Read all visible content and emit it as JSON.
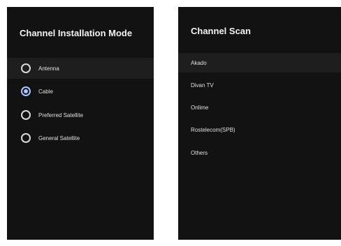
{
  "installation_mode": {
    "title": "Channel Installation Mode",
    "options": [
      {
        "label": "Antenna",
        "selected": false,
        "focused": true
      },
      {
        "label": "Cable",
        "selected": true,
        "focused": false
      },
      {
        "label": "Preferred Satellite",
        "selected": false,
        "focused": false
      },
      {
        "label": "General Satellite",
        "selected": false,
        "focused": false
      }
    ]
  },
  "channel_scan": {
    "title": "Channel Scan",
    "items": [
      {
        "label": "Akado",
        "focused": true
      },
      {
        "label": "Divan TV",
        "focused": false
      },
      {
        "label": "Onlime",
        "focused": false
      },
      {
        "label": "Rostelecom(SPB)",
        "focused": false
      },
      {
        "label": "Others",
        "focused": false
      }
    ]
  },
  "colors": {
    "panel_bg": "#121212",
    "focus_bg": "#1e1e1e",
    "accent": "#a8c6ff"
  }
}
